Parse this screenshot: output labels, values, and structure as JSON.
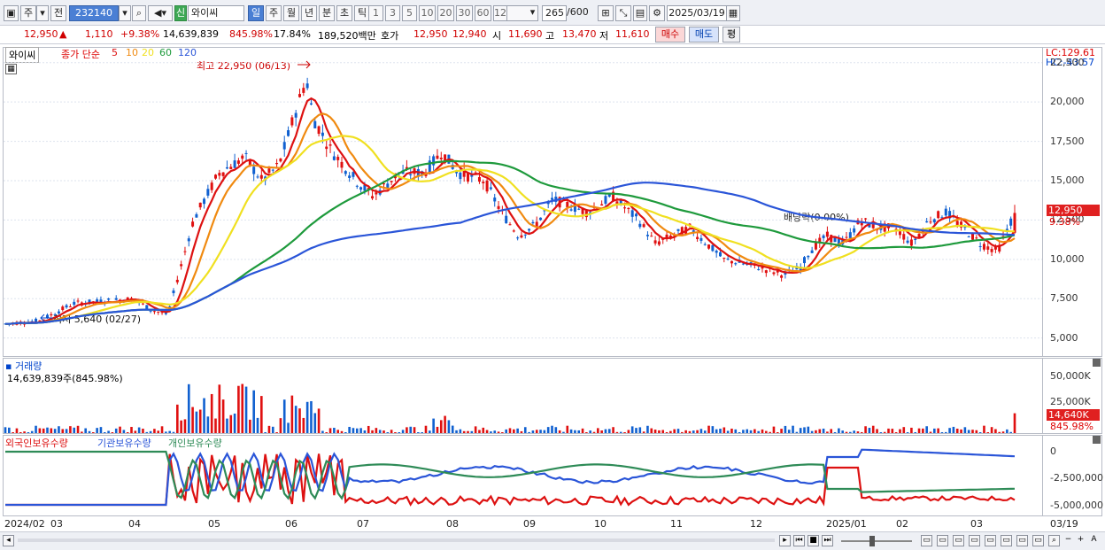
{
  "toolbar": {
    "period_label": "주",
    "prev_label": "전",
    "code_value": "232140",
    "stock_badge": "신",
    "stock_name": "와이씨",
    "period_tabs": [
      "일",
      "주",
      "월",
      "년",
      "분",
      "초",
      "틱"
    ],
    "interval_buttons": [
      "1",
      "3",
      "5",
      "10",
      "20",
      "30",
      "60",
      "120"
    ],
    "count_value": "265",
    "count_max": "/600",
    "date_value": "2025/03/19"
  },
  "quote": {
    "price": "12,950",
    "change_arrow": "▲",
    "change": "1,110",
    "change_pct": "+9.38%",
    "volume": "14,639,839",
    "volume_ratio": "845.98%",
    "turnover": "17.84%",
    "amount": "189,520백만",
    "ask_label": "호가",
    "ask": "12,950",
    "bid": "12,940",
    "open_label": "시",
    "open": "11,690",
    "high_label": "고",
    "high": "13,470",
    "low_label": "저",
    "low": "11,610",
    "buy_label": "매수",
    "sell_label": "매도",
    "eval_label": "평"
  },
  "price_pane": {
    "stock_tag": "와이씨",
    "legend_prefix": "종가 단순",
    "ma_labels": [
      "5",
      "10",
      "20",
      "60",
      "120"
    ],
    "ma_colors": [
      "#dd1111",
      "#f08a10",
      "#f0e020",
      "#1e9a3c",
      "#2a55d8"
    ],
    "high_annotation": "최고 22,950 (06/13)",
    "low_annotation": "최저 5,640 (02/27)",
    "dividend_annotation": "배당락(0.00%)",
    "lc_label": "LC:129.61",
    "hc_label": "HC:-43.57",
    "price_tag": "12,950",
    "pct_tag": "9.38%",
    "yaxis_labels": [
      "22,500",
      "20,000",
      "17,500",
      "15,000",
      "12,500",
      "10,000",
      "7,500",
      "5,000"
    ],
    "yaxis_values": [
      22500,
      20000,
      17500,
      15000,
      12500,
      10000,
      7500,
      5000
    ]
  },
  "volume_pane": {
    "title": "거래량",
    "value_label": "14,639,839주(845.98%)",
    "yaxis_labels": [
      "50,000K",
      "25,000K"
    ],
    "vol_tag": "14,640K",
    "vol_pct": "845.98%"
  },
  "holding_pane": {
    "legend": [
      "외국인보유수량",
      "기관보유수량",
      "개인보유수량"
    ],
    "colors": [
      "#dd1111",
      "#2a55d8",
      "#2e8b57"
    ],
    "yaxis_labels": [
      "0",
      "-2,500,000",
      "-5,000,000"
    ]
  },
  "xaxis": {
    "labels": [
      "2024/02",
      "03",
      "04",
      "05",
      "06",
      "07",
      "08",
      "09",
      "10",
      "11",
      "12",
      "2025/01",
      "02",
      "03"
    ],
    "right_label": "03/19"
  },
  "chart_data": {
    "type": "candlestick",
    "ylim": [
      3800,
      23500
    ],
    "close_approx_by_month": {
      "2024/02": 5900,
      "03": 12950,
      "04": 7000,
      "05": 14500,
      "06": 19500,
      "07": 14200,
      "08": 15800,
      "09": 11500,
      "10": 13600,
      "11": 11200,
      "12": 9000,
      "2025/01": 12000,
      "02": 12500
    },
    "high": 22950,
    "low": 5640,
    "last": 12950
  }
}
